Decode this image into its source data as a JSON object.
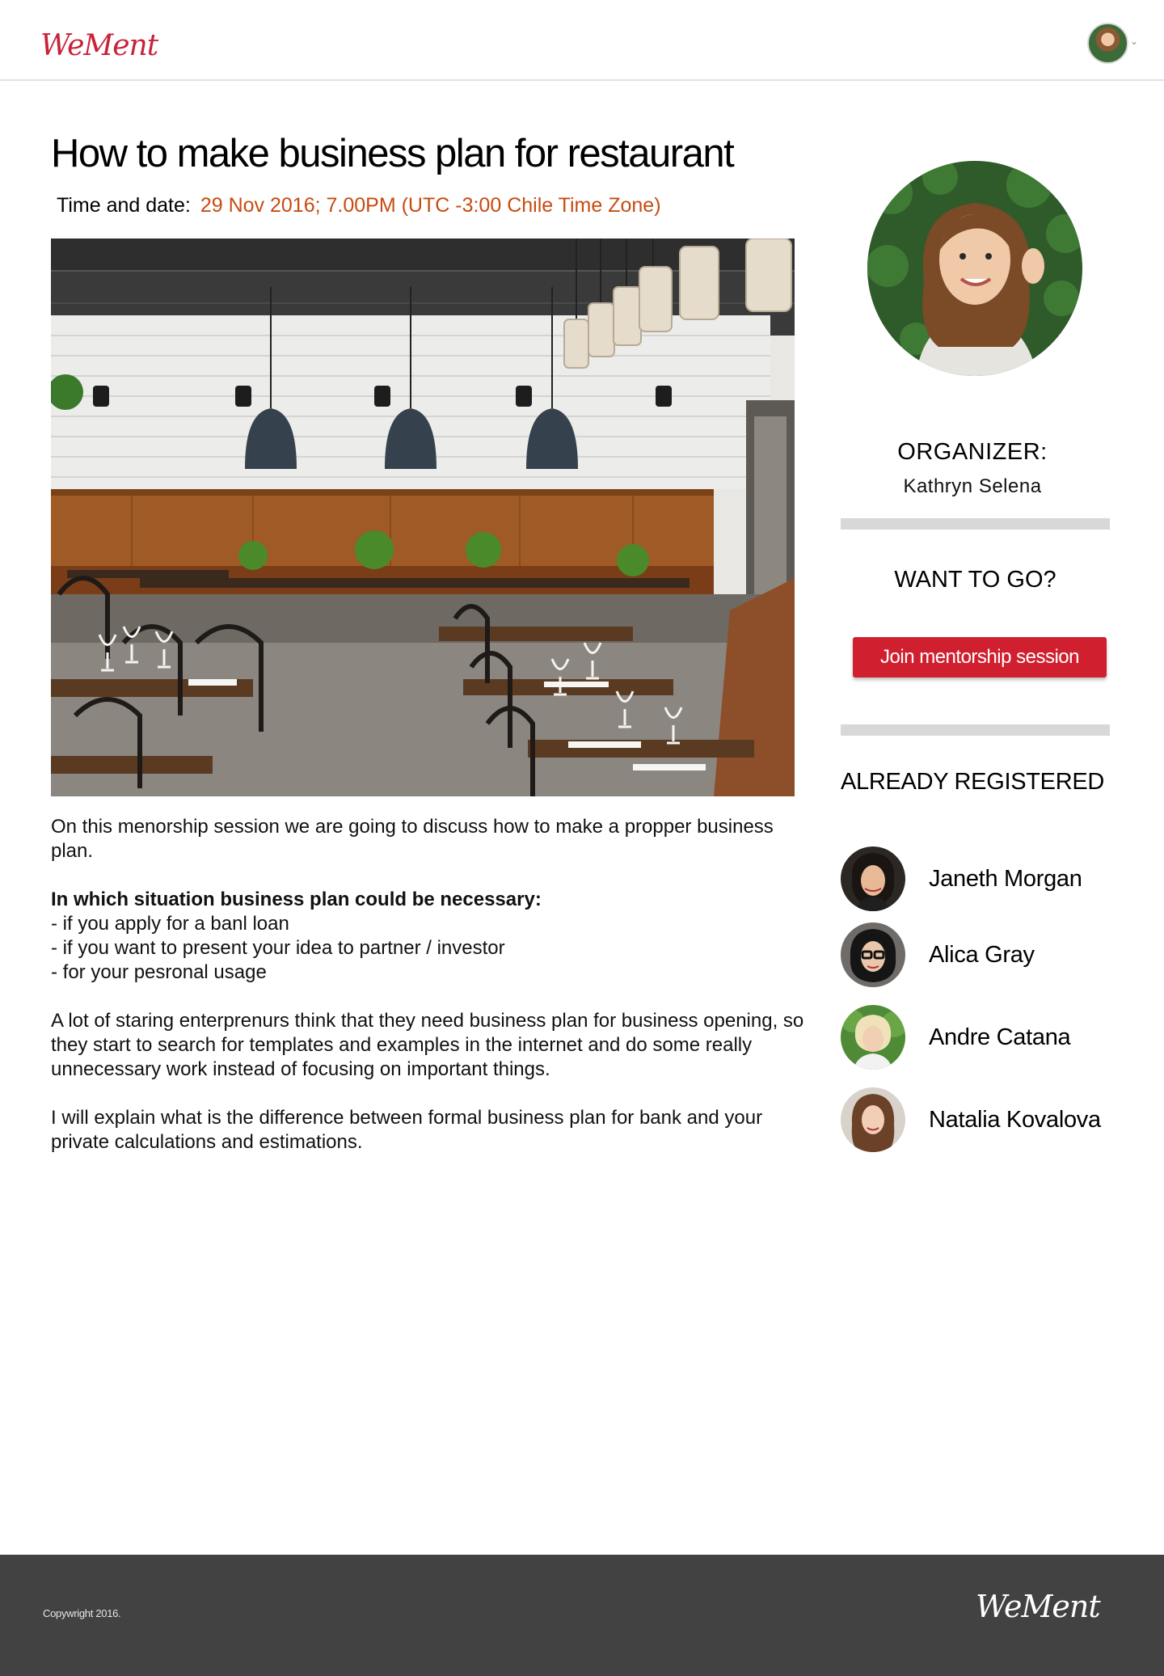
{
  "header": {
    "logo": "WeMent",
    "user_caret": "⌄"
  },
  "event": {
    "title": "How to make business plan for restaurant",
    "time_label": "Time and date:",
    "time_value": "29 Nov 2016; 7.00PM (UTC -3:00 Chile Time Zone)"
  },
  "description": {
    "intro": "On this menorship session we are going to discuss how to make a propper business plan.",
    "situations_heading": "In which situation business plan could be necessary:",
    "situations": [
      "- if you apply for a banl loan",
      "- if you want to present your idea to partner / investor",
      "- for your pesronal usage"
    ],
    "paragraph2": "A lot of staring enterprenurs think that they need business plan for business opening, so they start to search for templates and examples in the internet and do some really unnecessary work instead of focusing on important things.",
    "paragraph3": "I will explain what is the difference between formal business plan for bank and your private calculations and estimations."
  },
  "sidebar": {
    "organizer_label": "ORGANIZER:",
    "organizer_name": "Kathryn Selena",
    "want_label": "WANT TO GO?",
    "join_button": "Join mentorship session",
    "registered_label": "ALREADY REGISTERED",
    "attendees": [
      {
        "name": "Janeth Morgan"
      },
      {
        "name": "Alica Gray"
      },
      {
        "name": "Andre Catana"
      },
      {
        "name": "Natalia Kovalova"
      }
    ]
  },
  "footer": {
    "copyright": "Copywright 2016.",
    "logo": "WeMent"
  },
  "colors": {
    "brand_red": "#c8213a",
    "button_red": "#d0202f",
    "date_orange": "#c74b10",
    "footer_bg": "#424242"
  }
}
